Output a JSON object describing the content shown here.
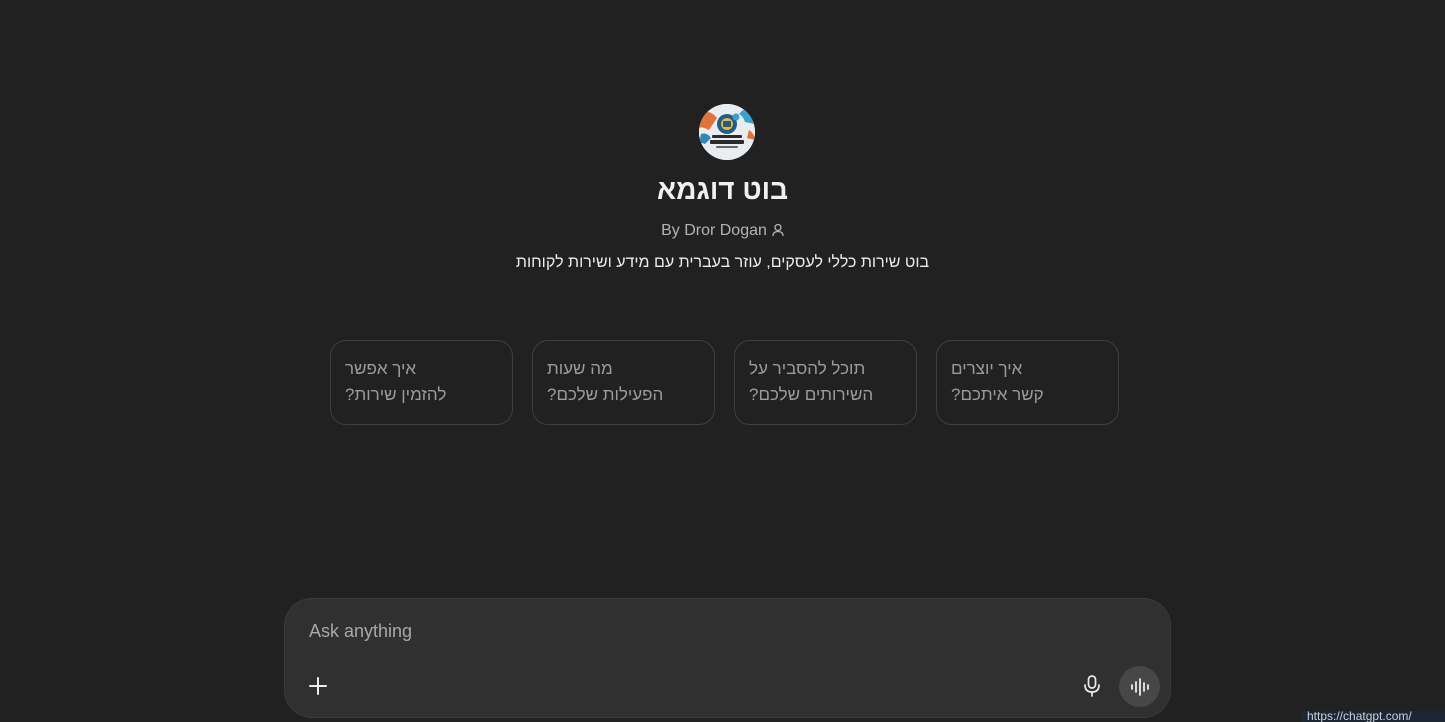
{
  "bot": {
    "name": "בוט דוגמא",
    "author": "By Dror Dogan",
    "description": "בוט שירות כללי לעסקים, עוזר בעברית עם מידע ושירות לקוחות",
    "avatar_icon": "business-assistant-logo"
  },
  "suggestions": [
    {
      "line1": "איך אפשר",
      "line2": "להזמין שירות?"
    },
    {
      "line1": "מה שעות",
      "line2": "הפעילות שלכם?"
    },
    {
      "line1": "תוכל להסביר על",
      "line2": "השירותים שלכם?"
    },
    {
      "line1": "איך יוצרים",
      "line2": "קשר איתכם?"
    }
  ],
  "composer": {
    "placeholder": "Ask anything",
    "add_icon": "plus-icon",
    "mic_icon": "microphone-icon",
    "voice_icon": "voice-mode-icon"
  },
  "status_bar": {
    "url": "https://chatgpt.com/"
  },
  "colors": {
    "background": "#212121",
    "composer": "#303030",
    "card_border": "#3f3f3f"
  }
}
